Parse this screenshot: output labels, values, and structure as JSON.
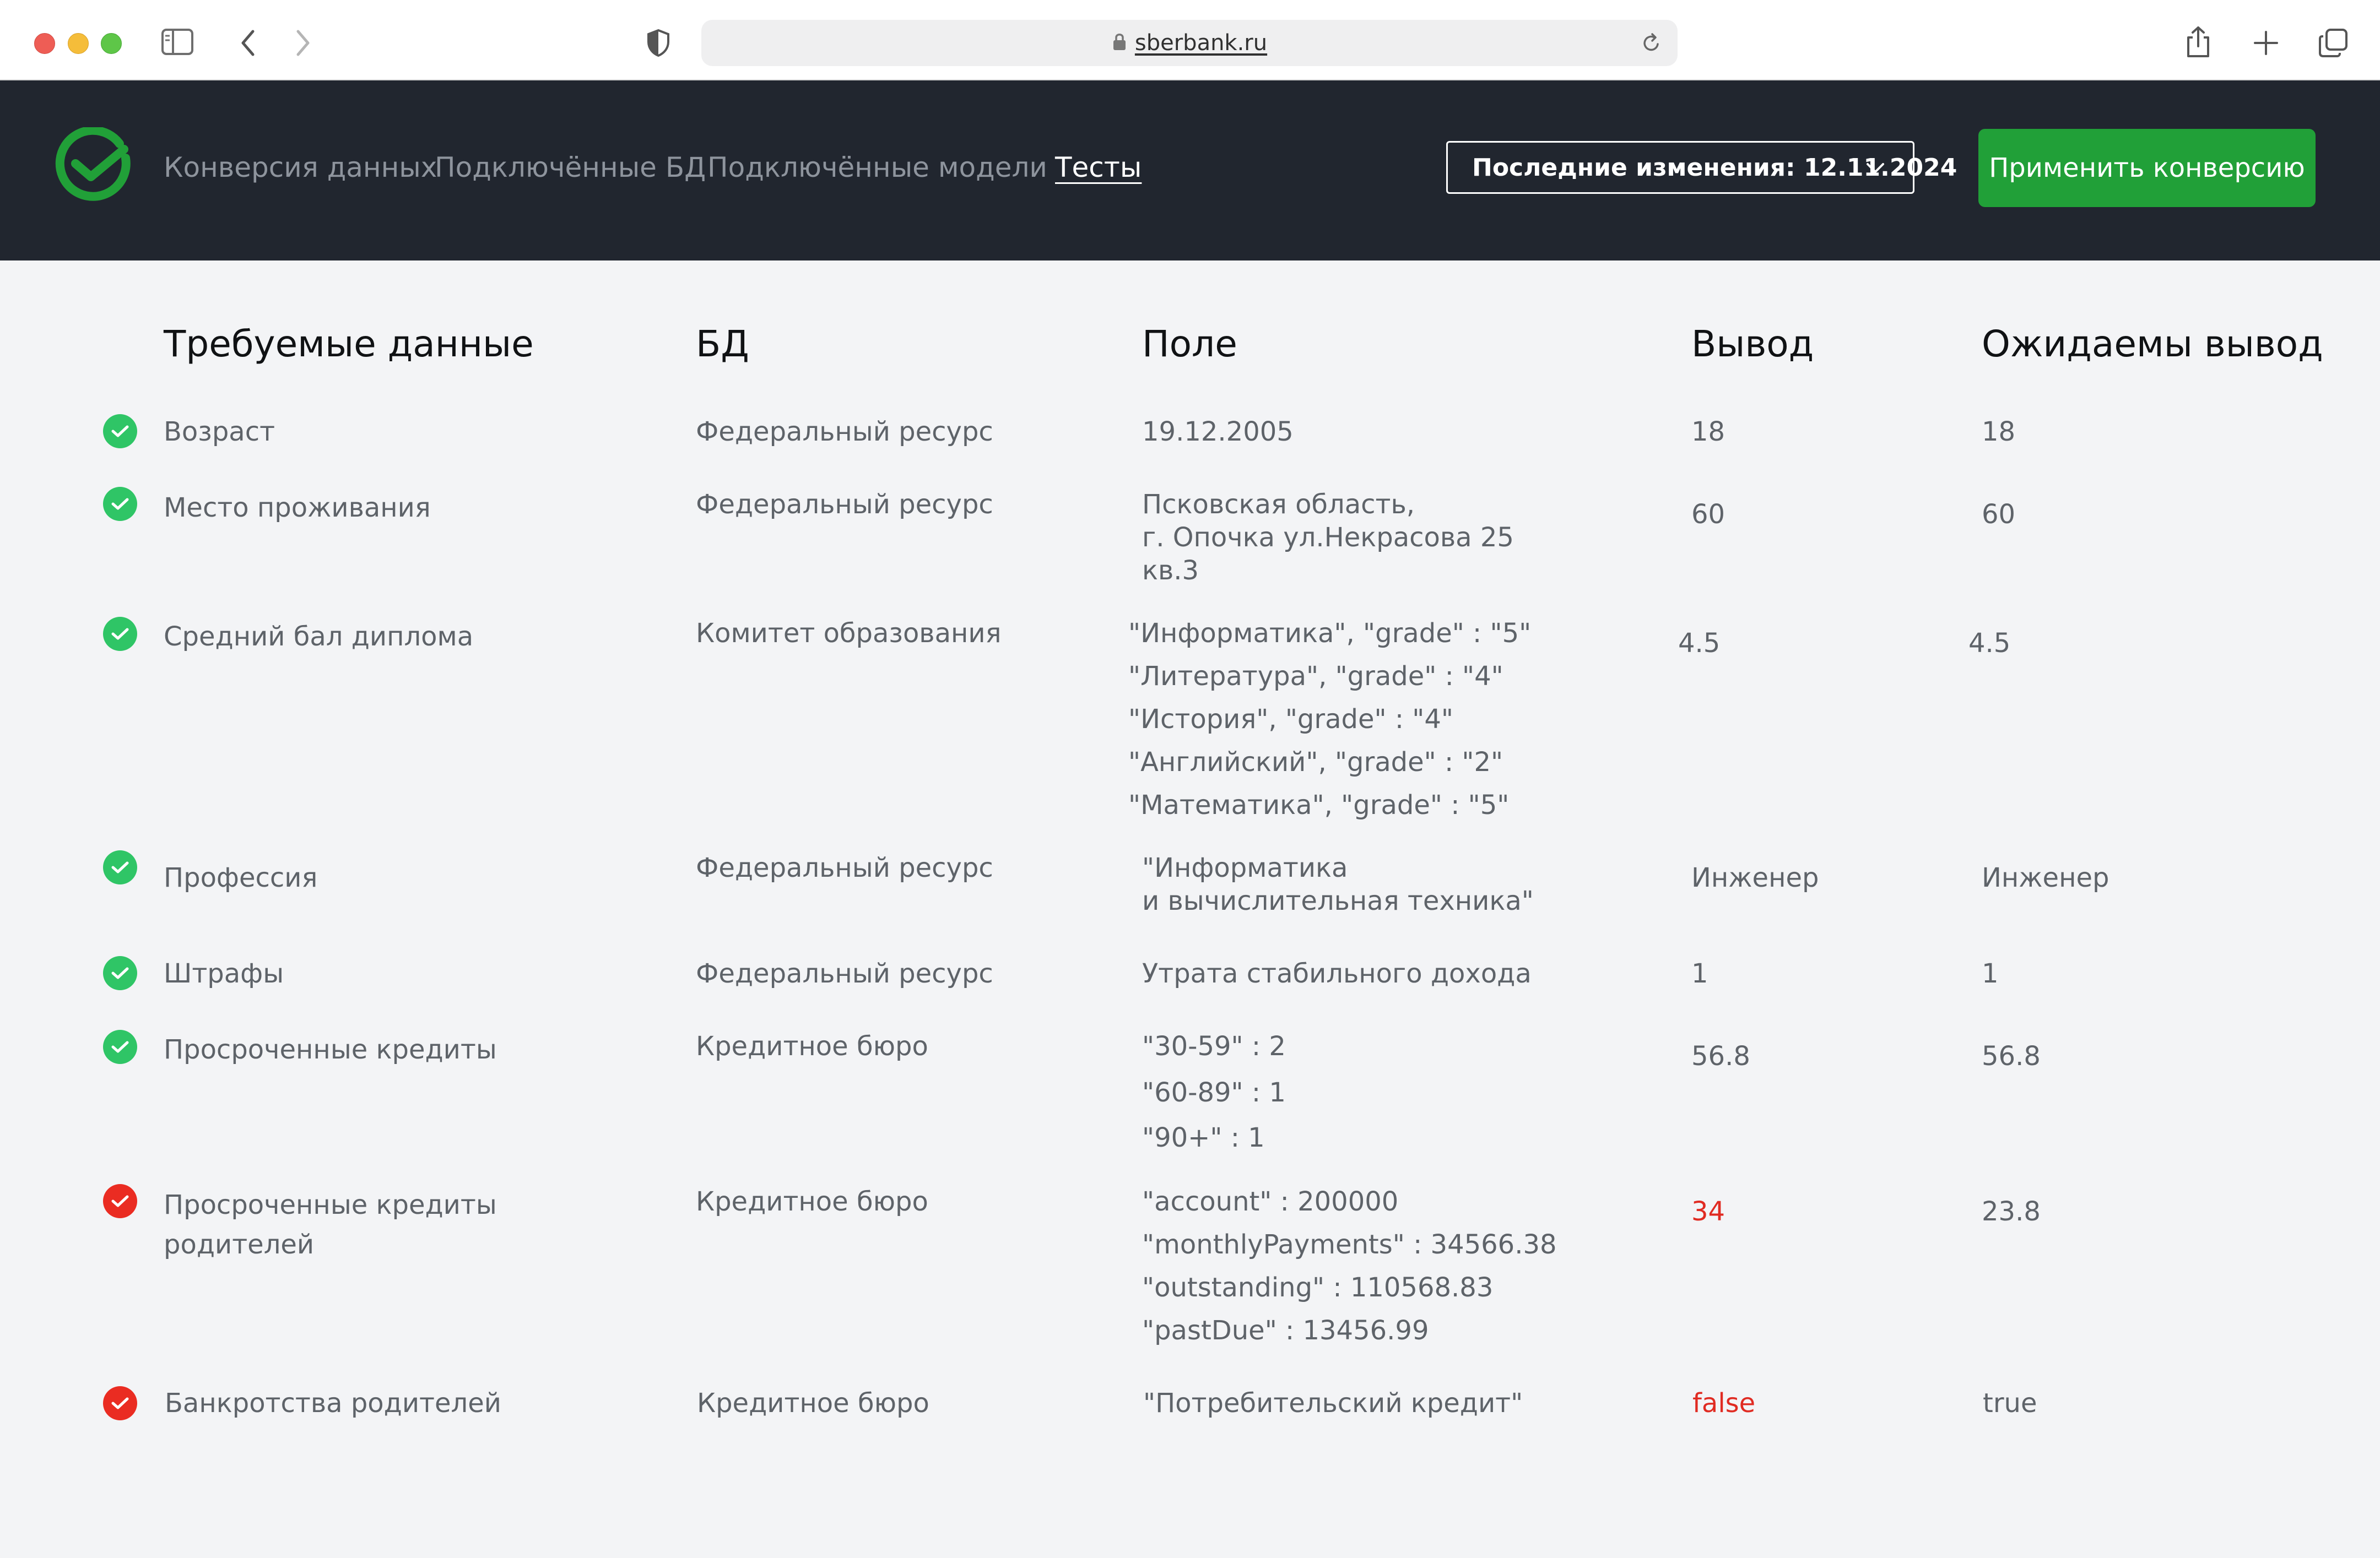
{
  "browser": {
    "url": "sberbank.ru"
  },
  "header": {
    "nav": [
      {
        "label": "Конверсия данных"
      },
      {
        "label": "Подключённые БД"
      },
      {
        "label": "Подключённые модели"
      },
      {
        "label": "Тесты",
        "active": true
      }
    ],
    "last_changes": "Последние изменения: 12.11.2024",
    "apply_button": "Применить конверсию"
  },
  "colors": {
    "brand_green": "#21a038",
    "header_bg": "#21262f",
    "ok": "#2fc566",
    "fail": "#ea2c22"
  },
  "table": {
    "columns": [
      "Требуемые данные",
      "БД",
      "Поле",
      "Вывод",
      "Ожидаемы вывод"
    ],
    "rows": [
      {
        "status": "ok",
        "data": "Возраст",
        "db": "Федеральный ресурс",
        "field": [
          "19.12.2005"
        ],
        "output": "18",
        "expected": "18",
        "mismatch": false
      },
      {
        "status": "ok",
        "data": "Место проживания",
        "db": "Федеральный ресурс",
        "field": [
          "Псковская область,",
          "г. Опочка ул.Некрасова 25",
          "кв.3"
        ],
        "output": "60",
        "expected": "60",
        "mismatch": false
      },
      {
        "status": "ok",
        "data": "Средний бал диплома",
        "db": "Комитет образования",
        "field": [
          "\"Информатика\", \"grade\" : \"5\"",
          "\"Литература\", \"grade\" : \"4\"",
          "\"История\", \"grade\" : \"4\"",
          "\"Английский\", \"grade\" : \"2\"",
          "\"Математика\", \"grade\" : \"5\""
        ],
        "output": "4.5",
        "expected": "4.5",
        "mismatch": false
      },
      {
        "status": "ok",
        "data": "Профессия",
        "db": "Федеральный ресурс",
        "field": [
          "\"Информатика",
          "и вычислительная техника\""
        ],
        "output": "Инженер",
        "expected": "Инженер",
        "mismatch": false
      },
      {
        "status": "ok",
        "data": "Штрафы",
        "db": "Федеральный ресурс",
        "field": [
          "Утрата стабильного дохода"
        ],
        "output": "1",
        "expected": "1",
        "mismatch": false
      },
      {
        "status": "ok",
        "data": "Просроченные кредиты",
        "db": "Кредитное бюро",
        "field": [
          "\"30-59\" : 2",
          "\"60-89\" : 1",
          "\"90+\" : 1"
        ],
        "output": "56.8",
        "expected": "56.8",
        "mismatch": false
      },
      {
        "status": "fail",
        "data": [
          "Просроченные кредиты",
          "родителей"
        ],
        "db": "Кредитное бюро",
        "field": [
          "\"account\" : 200000",
          "\"monthlyPayments\" : 34566.38",
          "\"outstanding\" : 110568.83",
          "\"pastDue\" : 13456.99"
        ],
        "output": "34",
        "expected": "23.8",
        "mismatch": true
      },
      {
        "status": "fail",
        "data": "Банкротства родителей",
        "db": "Кредитное бюро",
        "field": [
          "\"Потребительский кредит\""
        ],
        "output": "false",
        "expected": "true",
        "mismatch": true
      }
    ]
  }
}
